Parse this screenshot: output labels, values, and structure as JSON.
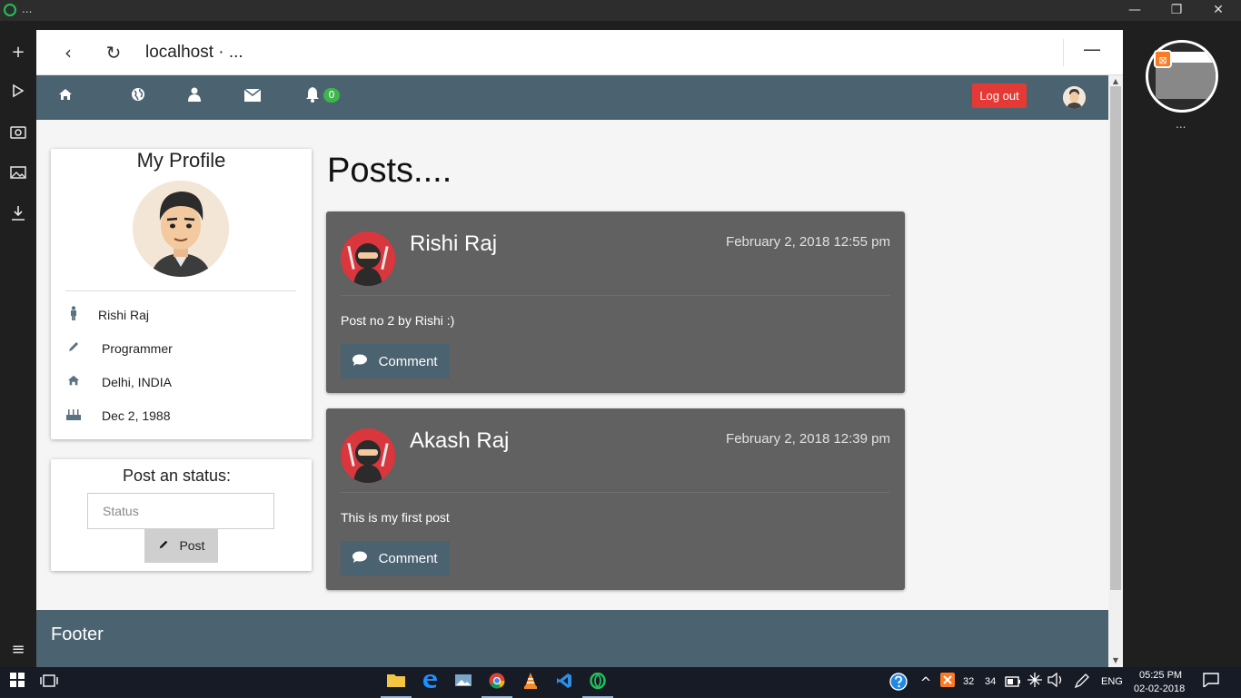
{
  "window": {
    "title": "...",
    "minimize": "—",
    "restore": "❐",
    "close": "✕"
  },
  "browser": {
    "url": "localhost · ...",
    "back": "‹",
    "reload": "↻",
    "menu": "—"
  },
  "nav": {
    "notification_count": "0",
    "logout_label": "Log out"
  },
  "profile": {
    "title": "My Profile",
    "name": "Rishi Raj",
    "occupation": "Programmer",
    "location": "Delhi, INDIA",
    "birthday": "Dec 2, 1988"
  },
  "status": {
    "title": "Post an status:",
    "placeholder": "Status",
    "post_label": "Post"
  },
  "posts": {
    "title": "Posts....",
    "items": [
      {
        "author": "Rishi Raj",
        "date": "February 2, 2018 12:55 pm",
        "text": "Post no 2 by Rishi :)",
        "comment_label": "Comment"
      },
      {
        "author": "Akash Raj",
        "date": "February 2, 2018 12:39 pm",
        "text": "This is my first post",
        "comment_label": "Comment"
      }
    ]
  },
  "footer": {
    "text": "Footer"
  },
  "right_panel": {
    "dots": "..."
  },
  "taskbar": {
    "time": "05:25 PM",
    "date": "02-02-2018",
    "lang": "ENG",
    "num1": "32",
    "num2": "34"
  },
  "colors": {
    "nav_bg": "#4b6270",
    "logout": "#e53935",
    "badge": "#3cb54a",
    "post_bg": "#616161"
  }
}
